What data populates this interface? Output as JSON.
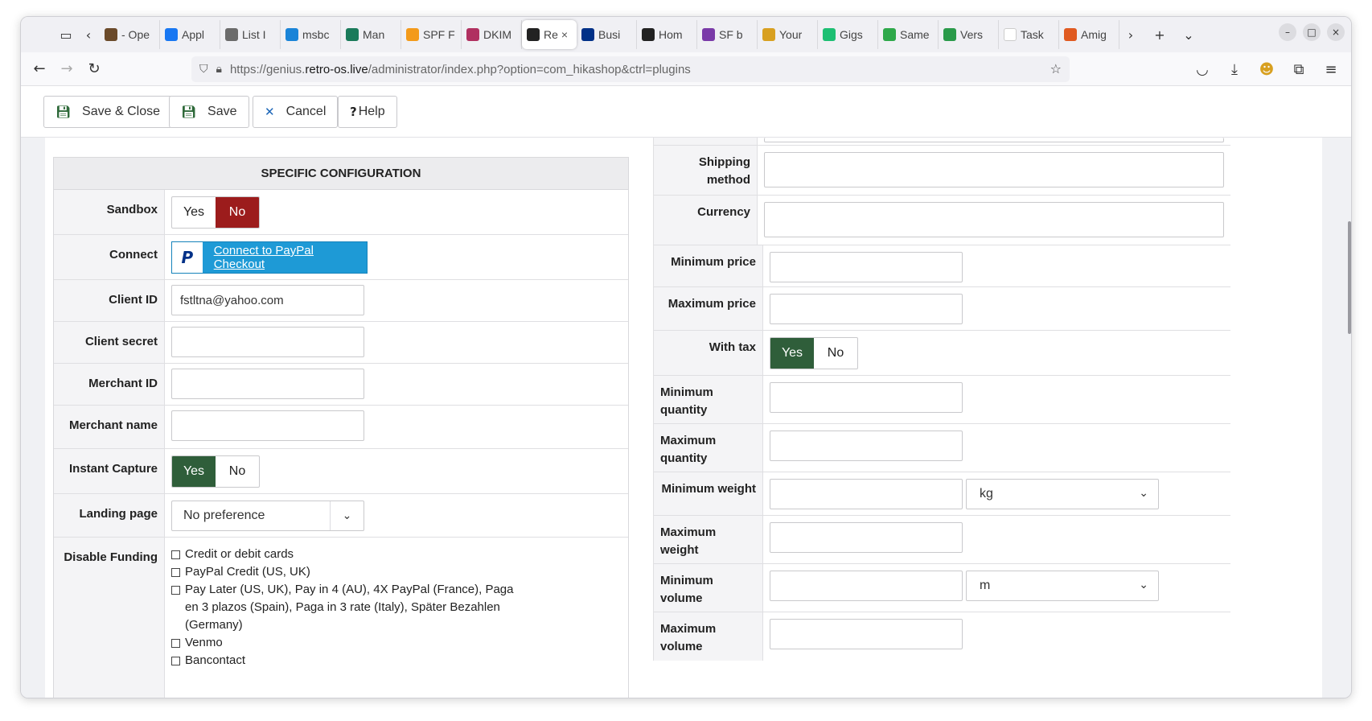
{
  "browser": {
    "tabs": [
      {
        "title": "- Ope",
        "color": "#6b4a2a"
      },
      {
        "title": "Appl",
        "color": "#1877f2"
      },
      {
        "title": "List I",
        "color": "#6b6b6b"
      },
      {
        "title": "msbc",
        "color": "#1a84d8"
      },
      {
        "title": "Man",
        "color": "#1a7a5a"
      },
      {
        "title": "SPF F",
        "color": "#f39a1a"
      },
      {
        "title": "DKIM",
        "color": "#b03060"
      },
      {
        "title": "Re",
        "color": "#222222"
      },
      {
        "title": "Busi",
        "color": "#003087"
      },
      {
        "title": "Hom",
        "color": "#222222"
      },
      {
        "title": "SF b",
        "color": "#7a3aa8"
      },
      {
        "title": "Your",
        "color": "#d8a020"
      },
      {
        "title": "Gigs",
        "color": "#1dbf73"
      },
      {
        "title": "Same",
        "color": "#2ea84a"
      },
      {
        "title": "Vers",
        "color": "#2a9a4a"
      },
      {
        "title": "Task",
        "color": "#ffffff"
      },
      {
        "title": "Amig",
        "color": "#e05a20"
      }
    ],
    "close_tab": "×",
    "url_prefix": "https://genius.",
    "url_host": "retro-os.live",
    "url_path": "/administrator/index.php?option=com_hikashop&ctrl=plugins"
  },
  "toolbar": {
    "save_close": "Save & Close",
    "save": "Save",
    "cancel": "Cancel",
    "help": "Help"
  },
  "left": {
    "header": "SPECIFIC CONFIGURATION",
    "sandbox": {
      "label": "Sandbox",
      "yes": "Yes",
      "no": "No"
    },
    "connect": {
      "label": "Connect",
      "button": "Connect to PayPal Checkout"
    },
    "client_id": {
      "label": "Client ID",
      "value": "fstltna@yahoo.com"
    },
    "client_secret": {
      "label": "Client secret"
    },
    "merchant_id": {
      "label": "Merchant ID"
    },
    "merchant_name": {
      "label": "Merchant name"
    },
    "instant_capture": {
      "label": "Instant Capture",
      "yes": "Yes",
      "no": "No"
    },
    "landing_page": {
      "label": "Landing page",
      "value": "No preference"
    },
    "disable_funding": {
      "label": "Disable Funding",
      "options": [
        "Credit or debit cards",
        "PayPal Credit (US, UK)",
        "Pay Later (US, UK), Pay in 4 (AU), 4X PayPal (France), Paga en 3 plazos (Spain), Paga in 3 rate (Italy), Später Bezahlen (Germany)",
        "Venmo",
        "Bancontact"
      ]
    }
  },
  "right": {
    "shipping_method": "Shipping method",
    "currency": "Currency",
    "min_price": "Minimum price",
    "max_price": "Maximum price",
    "with_tax": {
      "label": "With tax",
      "yes": "Yes",
      "no": "No"
    },
    "min_qty": "Minimum quantity",
    "max_qty": "Maximum quantity",
    "min_weight": {
      "label": "Minimum weight",
      "unit": "kg"
    },
    "max_weight": "Maximum weight",
    "min_volume": {
      "label": "Minimum volume",
      "unit": "m"
    },
    "max_volume": "Maximum volume"
  }
}
